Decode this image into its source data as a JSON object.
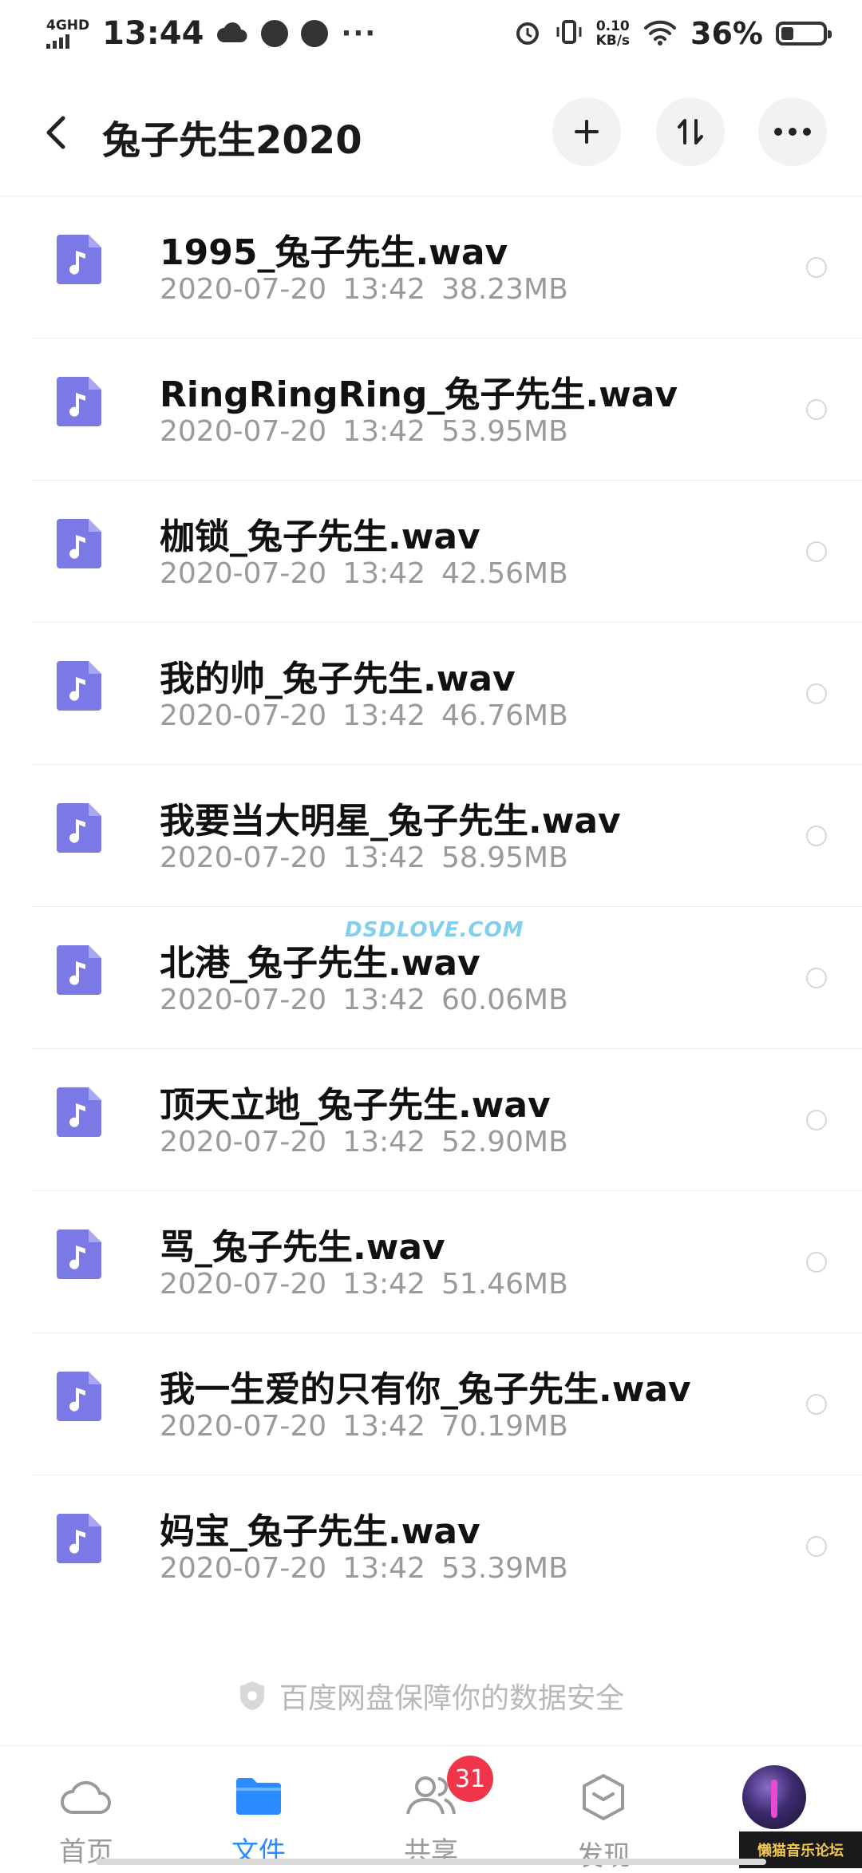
{
  "status_bar": {
    "network": "4GHD",
    "time": "13:44",
    "speed_value": "0.10",
    "speed_unit": "KB/s",
    "battery_percent": "36%"
  },
  "header": {
    "title": "兔子先生2020",
    "back_icon": "chevron-left-icon",
    "add_icon": "plus-icon",
    "sort_icon": "sort-icon",
    "more_icon": "more-icon"
  },
  "files": [
    {
      "name": "1995_兔子先生.wav",
      "date": "2020-07-20",
      "time": "13:42",
      "size": "38.23MB"
    },
    {
      "name": "RingRingRing_兔子先生.wav",
      "date": "2020-07-20",
      "time": "13:42",
      "size": "53.95MB"
    },
    {
      "name": "枷锁_兔子先生.wav",
      "date": "2020-07-20",
      "time": "13:42",
      "size": "42.56MB"
    },
    {
      "name": "我的帅_兔子先生.wav",
      "date": "2020-07-20",
      "time": "13:42",
      "size": "46.76MB"
    },
    {
      "name": "我要当大明星_兔子先生.wav",
      "date": "2020-07-20",
      "time": "13:42",
      "size": "58.95MB"
    },
    {
      "name": "北港_兔子先生.wav",
      "date": "2020-07-20",
      "time": "13:42",
      "size": "60.06MB"
    },
    {
      "name": "顶天立地_兔子先生.wav",
      "date": "2020-07-20",
      "time": "13:42",
      "size": "52.90MB"
    },
    {
      "name": "骂_兔子先生.wav",
      "date": "2020-07-20",
      "time": "13:42",
      "size": "51.46MB"
    },
    {
      "name": "我一生爱的只有你_兔子先生.wav",
      "date": "2020-07-20",
      "time": "13:42",
      "size": "70.19MB"
    },
    {
      "name": "妈宝_兔子先生.wav",
      "date": "2020-07-20",
      "time": "13:42",
      "size": "53.39MB"
    }
  ],
  "watermark": "DSDLOVE.COM",
  "footer_note": "百度网盘保障你的数据安全",
  "nav": {
    "home": "首页",
    "files": "文件",
    "share": "共享",
    "discover": "发现",
    "share_badge": "31"
  },
  "forum_logo": "懒猫音乐论坛",
  "colors": {
    "accent": "#2b8cff",
    "file_icon": "#7b79e6",
    "badge": "#f0354b"
  }
}
